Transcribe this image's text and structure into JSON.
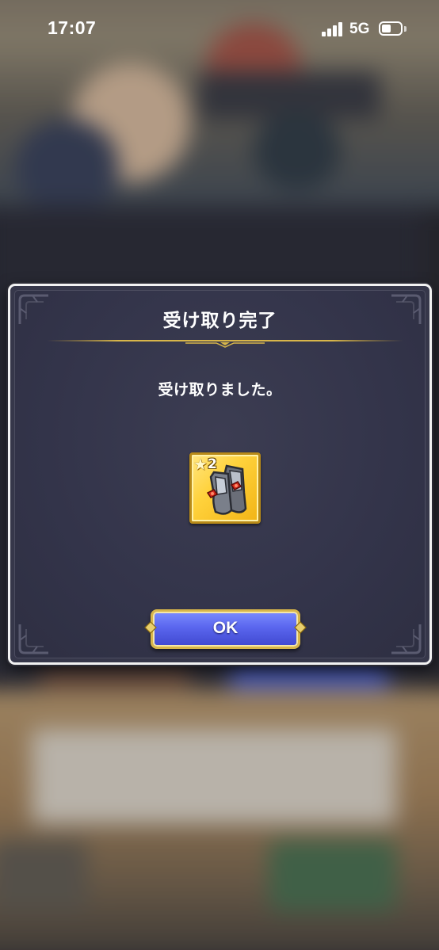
{
  "status_bar": {
    "time": "17:07",
    "network": "5G",
    "signal_bars": 4,
    "battery_level": 0.5
  },
  "dialog": {
    "title": "受け取り完了",
    "message": "受け取りました。",
    "reward": {
      "icon": "gauntlets-icon",
      "rarity_symbol": "★",
      "rarity": "2"
    },
    "ok_label": "OK"
  },
  "colors": {
    "dialog_bg": "#36374a",
    "gold_accent": "#d8b64a",
    "ok_button": "#5a66ee",
    "item_frame": "#ffd23c"
  }
}
